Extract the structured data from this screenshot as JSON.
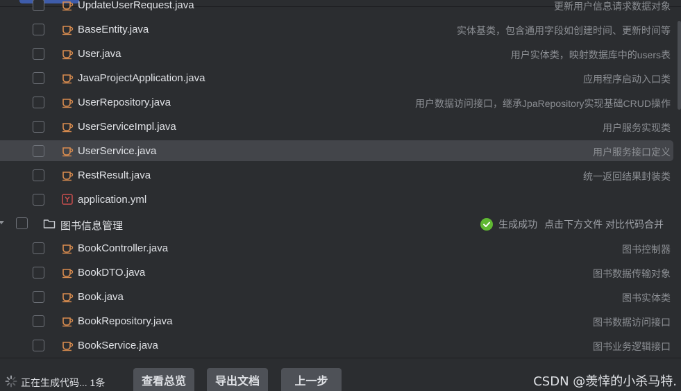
{
  "files_top": [
    {
      "name": "UpdateUserRequest.java",
      "desc": "更新用户信息请求数据对象",
      "type": "java"
    },
    {
      "name": "BaseEntity.java",
      "desc": "实体基类，包含通用字段如创建时间、更新时间等",
      "type": "java"
    },
    {
      "name": "User.java",
      "desc": "用户实体类，映射数据库中的users表",
      "type": "java"
    },
    {
      "name": "JavaProjectApplication.java",
      "desc": "应用程序启动入口类",
      "type": "java"
    },
    {
      "name": "UserRepository.java",
      "desc": "用户数据访问接口，继承JpaRepository实现基础CRUD操作",
      "type": "java"
    },
    {
      "name": "UserServiceImpl.java",
      "desc": "用户服务实现类",
      "type": "java"
    },
    {
      "name": "UserService.java",
      "desc": "用户服务接口定义",
      "type": "java",
      "selected": true
    },
    {
      "name": "RestResult.java",
      "desc": "统一返回结果封装类",
      "type": "java"
    },
    {
      "name": "application.yml",
      "desc": "",
      "type": "yaml"
    }
  ],
  "folder": {
    "name": "图书信息管理",
    "status": "生成成功",
    "hint": "点击下方文件 对比代码合并"
  },
  "files_folder": [
    {
      "name": "BookController.java",
      "desc": "图书控制器",
      "type": "java"
    },
    {
      "name": "BookDTO.java",
      "desc": "图书数据传输对象",
      "type": "java"
    },
    {
      "name": "Book.java",
      "desc": "图书实体类",
      "type": "java"
    },
    {
      "name": "BookRepository.java",
      "desc": "图书数据访问接口",
      "type": "java"
    },
    {
      "name": "BookService.java",
      "desc": "图书业务逻辑接口",
      "type": "java"
    }
  ],
  "footer": {
    "generating": "正在生成代码... 1条",
    "btn_overview": "查看总览",
    "btn_export": "导出文档",
    "btn_prev": "上一步",
    "watermark": "CSDN @羡悻的小杀马特."
  },
  "colors": {
    "java_icon": "#d98c4f",
    "yaml_icon": "#c94f4f",
    "success": "#5fb832"
  }
}
